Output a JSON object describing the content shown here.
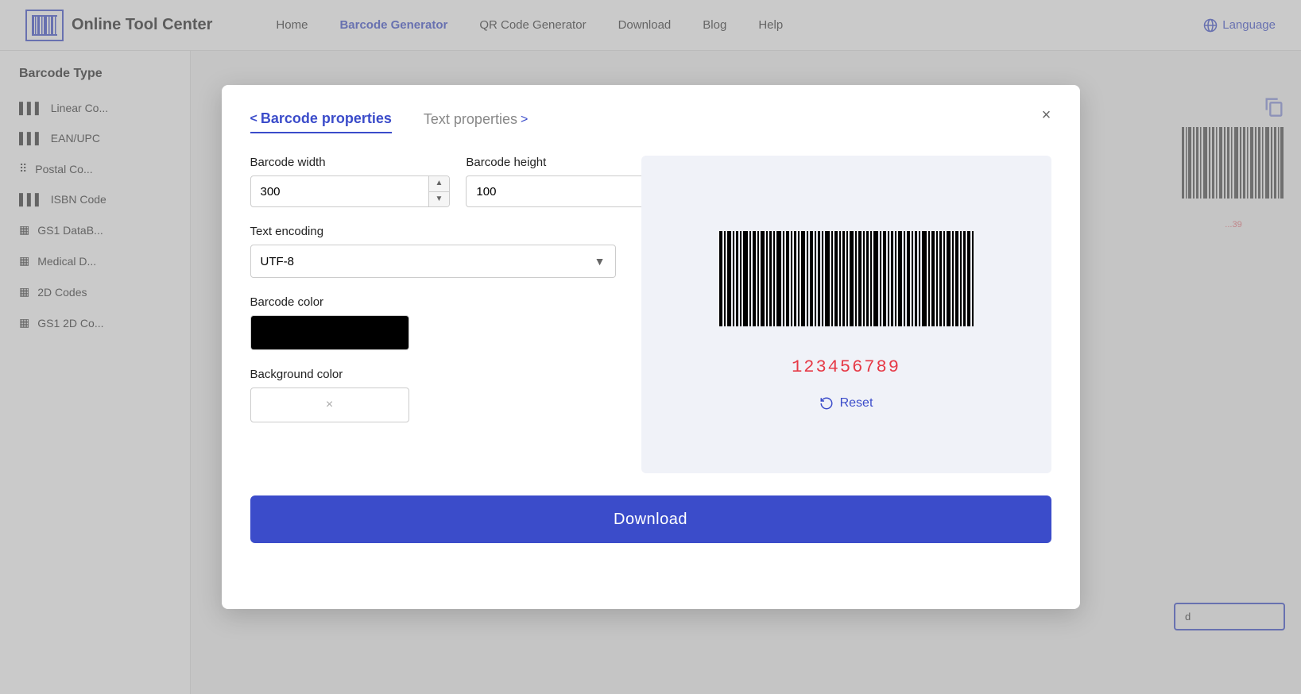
{
  "app": {
    "title": "Online Tool Center"
  },
  "navbar": {
    "logo_text": "Online Tool Center",
    "links": [
      {
        "label": "Home",
        "active": false
      },
      {
        "label": "Barcode Generator",
        "active": true
      },
      {
        "label": "QR Code Generator",
        "active": false
      },
      {
        "label": "Download",
        "active": false
      },
      {
        "label": "Blog",
        "active": false
      },
      {
        "label": "Help",
        "active": false
      }
    ],
    "language_label": "Language"
  },
  "sidebar": {
    "title": "Barcode Type",
    "items": [
      {
        "label": "Linear Co...",
        "icon": "barcode"
      },
      {
        "label": "EAN/UPC",
        "icon": "barcode"
      },
      {
        "label": "Postal Co...",
        "icon": "postal"
      },
      {
        "label": "ISBN Code",
        "icon": "barcode"
      },
      {
        "label": "GS1 DataB...",
        "icon": "gs1"
      },
      {
        "label": "Medical D...",
        "icon": "medical"
      },
      {
        "label": "2D Codes",
        "icon": "qr"
      },
      {
        "label": "GS1 2D Co...",
        "icon": "gs1-2d"
      }
    ]
  },
  "modal": {
    "tab_barcode": "Barcode properties",
    "tab_text": "Text properties",
    "close_label": "×",
    "barcode_width_label": "Barcode width",
    "barcode_width_value": "300",
    "barcode_height_label": "Barcode height",
    "barcode_height_value": "100",
    "text_encoding_label": "Text encoding",
    "text_encoding_value": "UTF-8",
    "barcode_color_label": "Barcode color",
    "background_color_label": "Background color",
    "reset_label": "Reset",
    "download_label": "Download",
    "barcode_number": "123456789"
  }
}
